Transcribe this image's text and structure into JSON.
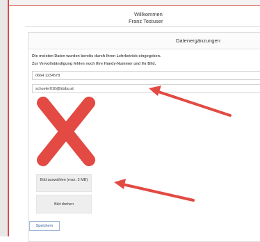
{
  "header": {
    "welcome": "Willkommen",
    "username": "Franz Testuser"
  },
  "card": {
    "title": "Datenergänzungen",
    "info_line1": "Die meisten Daten wurden bereits durch Ihren Lehrbetrieb eingegeben.",
    "info_line2": "Zur Vervollständigung fehlen noch Ihre Handy-Nummer und Ihr Bild.",
    "phone_value": "0664 1234578",
    "email_value": "schueler010@ldsbu.at",
    "select_image_label": "Bild auswählen (max. 3 MB)",
    "rotate_image_label": "Bild drehen",
    "save_label": "Speichern"
  },
  "colors": {
    "accent_red": "#d84b47",
    "placeholder_x": "#e24a43",
    "save_text": "#2d5aa0"
  },
  "icons": {
    "image_placeholder": "red-x-icon",
    "annotation": "arrow-icon"
  }
}
